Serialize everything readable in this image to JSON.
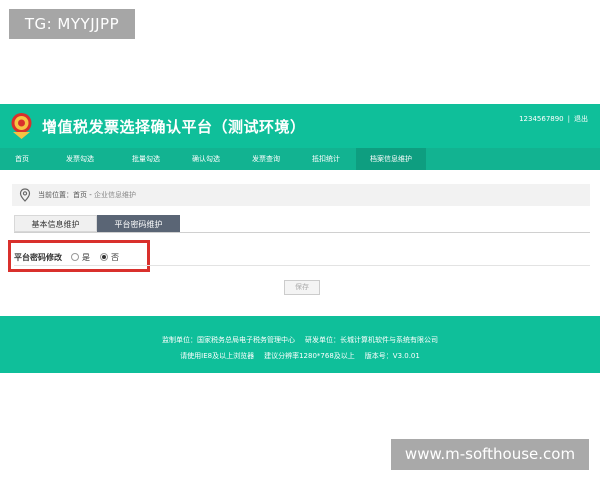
{
  "watermarks": {
    "top": "TG: MYYJJPP",
    "bottom": "www.m-softhouse.com"
  },
  "header": {
    "title": "增值税发票选择确认平台（测试环境）",
    "user_id": "1234567890",
    "separator": "|",
    "exit_label": "退出",
    "emblem_icon": "tax-emblem-icon"
  },
  "nav": {
    "items": [
      {
        "label": "首页",
        "width": 44
      },
      {
        "label": "发票勾选",
        "width": 72
      },
      {
        "label": "批量勾选",
        "width": 60
      },
      {
        "label": "确认勾选",
        "width": 60
      },
      {
        "label": "发票查询",
        "width": 60
      },
      {
        "label": "抵扣统计",
        "width": 60
      },
      {
        "label": "档案信息维护",
        "width": 70,
        "active": true
      }
    ]
  },
  "breadcrumb": {
    "prefix": "当前位置：",
    "home": "首页",
    "divider": " - ",
    "current": "企业信息维护"
  },
  "subtabs": {
    "basic": "基本信息维护",
    "password": "平台密码维护"
  },
  "form": {
    "label": "平台密码修改",
    "options": [
      {
        "label": "是",
        "checked": false
      },
      {
        "label": "否",
        "checked": true
      }
    ]
  },
  "save_button": "保存",
  "footer": {
    "supervisor_label": "监制单位：",
    "supervisor": "国家税务总局电子税务管理中心",
    "developer_label": "研发单位：",
    "developer": "长城计算机软件与系统有限公司",
    "browser": "请使用IE8及以上浏览器",
    "resolution": "建议分辨率1280*768及以上",
    "version": "版本号：V3.0.01"
  },
  "colors": {
    "brand": "#0fbf9a",
    "nav": "#12b391",
    "nav_active": "#0e9e80",
    "highlight": "#d9302c"
  }
}
